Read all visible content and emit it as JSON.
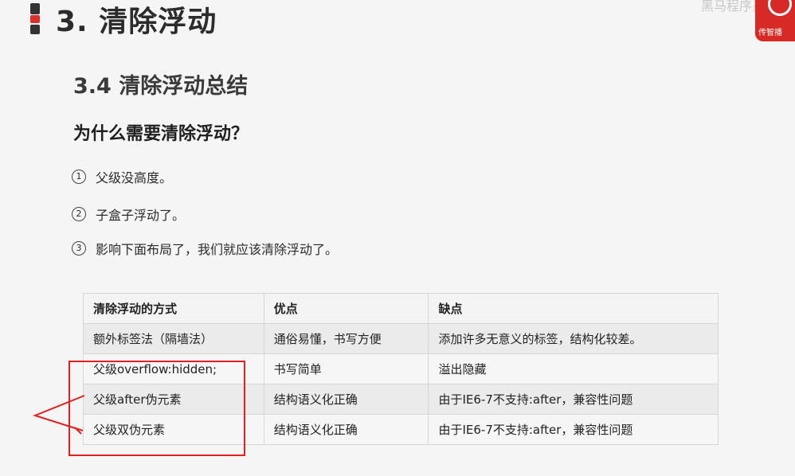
{
  "header": {
    "title": "3. 清除浮动",
    "logo_text": "传智播",
    "watermark": "黑马程序员"
  },
  "section": {
    "subtitle": "3.4 清除浮动总结",
    "question": "为什么需要清除浮动？"
  },
  "reasons": [
    {
      "num": "1",
      "text": "父级没高度。"
    },
    {
      "num": "2",
      "text": "子盒子浮动了。"
    },
    {
      "num": "3",
      "text": "影响下面布局了，我们就应该清除浮动了。"
    }
  ],
  "table": {
    "headers": [
      "清除浮动的方式",
      "优点",
      "缺点"
    ],
    "rows": [
      [
        "额外标签法（隔墙法）",
        "通俗易懂，书写方便",
        "添加许多无意义的标签，结构化较差。"
      ],
      [
        "父级overflow:hidden;",
        "书写简单",
        "溢出隐藏"
      ],
      [
        "父级after伪元素",
        "结构语义化正确",
        "由于IE6-7不支持:after，兼容性问题"
      ],
      [
        "父级双伪元素",
        "结构语义化正确",
        "由于IE6-7不支持:after，兼容性问题"
      ]
    ]
  },
  "colors": {
    "accent": "#d72a26",
    "annotation": "#e32020"
  }
}
